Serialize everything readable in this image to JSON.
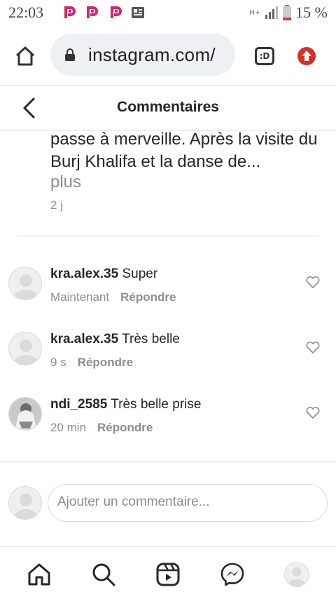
{
  "statusbar": {
    "time": "22:03",
    "network": "H+",
    "battery": "15 %"
  },
  "browser": {
    "url": "instagram.com/",
    "tabs_label": ":D"
  },
  "header": {
    "title": "Commentaires"
  },
  "caption": {
    "line1": "passe à merveille. Après la visite du",
    "line2": "Burj Khalifa et la danse de...",
    "more": "plus",
    "time": "2 j"
  },
  "comments": [
    {
      "user": "kra.alex.35",
      "text": "Super",
      "time": "Maintenant",
      "reply": "Répondre"
    },
    {
      "user": "kra.alex.35",
      "text": "Très belle",
      "time": "9 s",
      "reply": "Répondre"
    },
    {
      "user": "ndi_2585",
      "text": "Très belle prise",
      "time": "20 min",
      "reply": "Répondre"
    }
  ],
  "composer": {
    "placeholder": "Ajouter un commentaire..."
  },
  "colors": {
    "text": "#262626",
    "secondary": "#8e8e8e",
    "border": "#dbdbdb",
    "app_icon_pink": "#e0245e",
    "upload_red": "#d93025"
  }
}
